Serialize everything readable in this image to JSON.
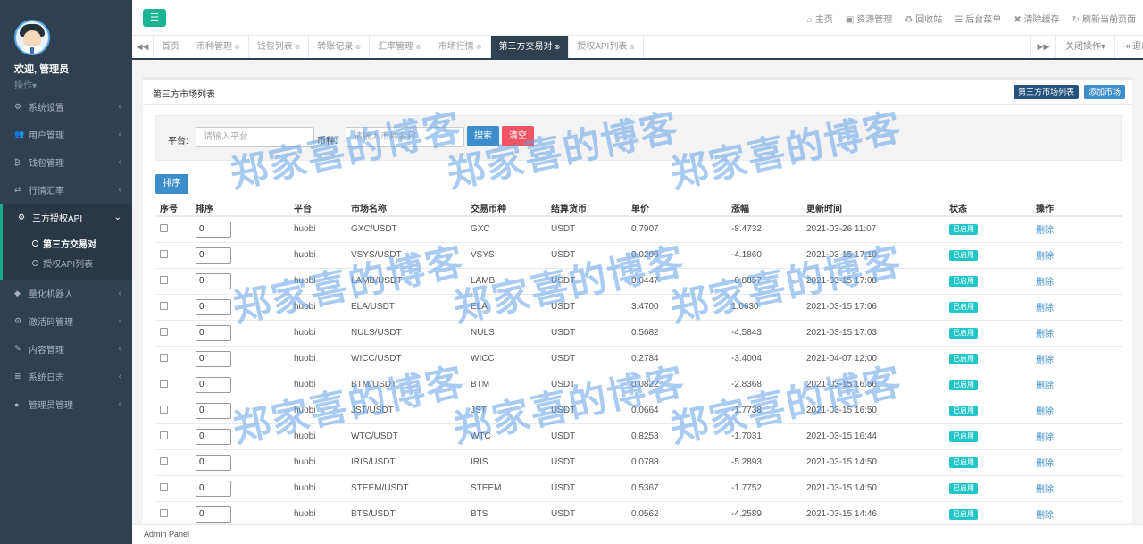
{
  "sidebar": {
    "welcome": "欢迎, 管理员",
    "operations": "操作▾",
    "menu_before": [
      {
        "label": "系统设置",
        "icon": "⚙",
        "name": "cog-icon"
      },
      {
        "label": "用户管理",
        "icon": "👥",
        "name": "users-icon"
      },
      {
        "label": "钱包管理",
        "icon": "₿",
        "name": "bitcoin-icon"
      },
      {
        "label": "行情汇率",
        "icon": "⇄",
        "name": "exchange-icon"
      }
    ],
    "active_menu": {
      "label": "三方授权API",
      "icon": "⚙"
    },
    "submenu": [
      {
        "label": "第三方交易对"
      },
      {
        "label": "授权API列表"
      }
    ],
    "menu_after": [
      {
        "label": "量化机器人",
        "icon": "◆",
        "name": "robot-icon"
      },
      {
        "label": "激活码管理",
        "icon": "⚙",
        "name": "key-icon"
      },
      {
        "label": "内容管理",
        "icon": "✎",
        "name": "edit-icon"
      },
      {
        "label": "系统日志",
        "icon": "≣",
        "name": "log-icon"
      },
      {
        "label": "管理员管理",
        "icon": "●",
        "name": "admin-icon"
      }
    ]
  },
  "topbar": {
    "actions": [
      {
        "label": "主页",
        "icon": "⌂"
      },
      {
        "label": "资源管理",
        "icon": "▣"
      },
      {
        "label": "回收站",
        "icon": "♻"
      },
      {
        "label": "后台菜单",
        "icon": "☰"
      },
      {
        "label": "清除缓存",
        "icon": "✖"
      },
      {
        "label": "刷新当前页面",
        "icon": "↻"
      }
    ]
  },
  "tabs": [
    {
      "label": "首页",
      "closable": false,
      "active": false
    },
    {
      "label": "币种管理",
      "closable": true,
      "active": false
    },
    {
      "label": "钱包列表",
      "closable": true,
      "active": false
    },
    {
      "label": "转账记录",
      "closable": true,
      "active": false
    },
    {
      "label": "汇率管理",
      "closable": true,
      "active": false
    },
    {
      "label": "市场行情",
      "closable": true,
      "active": false
    },
    {
      "label": "第三方交易对",
      "closable": true,
      "active": true
    },
    {
      "label": "授权API列表",
      "closable": true,
      "active": false
    }
  ],
  "tab_right": {
    "close_ops": "关闭操作▾",
    "exit": "退出"
  },
  "panel": {
    "title": "第三方市场列表",
    "btn_list": "第三方市场列表",
    "btn_add": "添加市场"
  },
  "search": {
    "platform_label": "平台:",
    "platform_placeholder": "请输入平台",
    "coin_label": "币种:",
    "coin_placeholder": "请输入币种名称",
    "search_btn": "搜索",
    "clear_btn": "清空"
  },
  "sort_btn": "排序",
  "table": {
    "headers": [
      "序号",
      "排序",
      "平台",
      "市场名称",
      "交易币种",
      "结算货币",
      "单价",
      "涨幅",
      "更新时间",
      "状态",
      "操作"
    ],
    "rows": [
      {
        "sort": "0",
        "platform": "huobi",
        "market": "GXC/USDT",
        "coin": "GXC",
        "settle": "USDT",
        "price": "0.7907",
        "change": "-8.4732",
        "time": "2021-03-26 11:07",
        "status": "已启用",
        "action": "删除"
      },
      {
        "sort": "0",
        "platform": "huobi",
        "market": "VSYS/USDT",
        "coin": "VSYS",
        "settle": "USDT",
        "price": "0.0206",
        "change": "-4.1860",
        "time": "2021-03-15 17:10",
        "status": "已启用",
        "action": "删除"
      },
      {
        "sort": "0",
        "platform": "huobi",
        "market": "LAMB/USDT",
        "coin": "LAMB",
        "settle": "USDT",
        "price": "0.0447",
        "change": "-0.8857",
        "time": "2021-03-15 17:08",
        "status": "已启用",
        "action": "删除"
      },
      {
        "sort": "0",
        "platform": "huobi",
        "market": "ELA/USDT",
        "coin": "ELA",
        "settle": "USDT",
        "price": "3.4700",
        "change": "1.0630",
        "time": "2021-03-15 17:06",
        "status": "已启用",
        "action": "删除"
      },
      {
        "sort": "0",
        "platform": "huobi",
        "market": "NULS/USDT",
        "coin": "NULS",
        "settle": "USDT",
        "price": "0.5682",
        "change": "-4.5843",
        "time": "2021-03-15 17:03",
        "status": "已启用",
        "action": "删除"
      },
      {
        "sort": "0",
        "platform": "huobi",
        "market": "WICC/USDT",
        "coin": "WICC",
        "settle": "USDT",
        "price": "0.2784",
        "change": "-3.4004",
        "time": "2021-04-07 12:00",
        "status": "已启用",
        "action": "删除"
      },
      {
        "sort": "0",
        "platform": "huobi",
        "market": "BTM/USDT",
        "coin": "BTM",
        "settle": "USDT",
        "price": "0.0822",
        "change": "-2.8368",
        "time": "2021-03-15 16:56",
        "status": "已启用",
        "action": "删除"
      },
      {
        "sort": "0",
        "platform": "huobi",
        "market": "JST/USDT",
        "coin": "JST",
        "settle": "USDT",
        "price": "0.0664",
        "change": "-1.7738",
        "time": "2021-03-15 16:50",
        "status": "已启用",
        "action": "删除"
      },
      {
        "sort": "0",
        "platform": "huobi",
        "market": "WTC/USDT",
        "coin": "WTC",
        "settle": "USDT",
        "price": "0.8253",
        "change": "-1.7031",
        "time": "2021-03-15 16:44",
        "status": "已启用",
        "action": "删除"
      },
      {
        "sort": "0",
        "platform": "huobi",
        "market": "IRIS/USDT",
        "coin": "IRIS",
        "settle": "USDT",
        "price": "0.0788",
        "change": "-5.2893",
        "time": "2021-03-15 14:50",
        "status": "已启用",
        "action": "删除"
      },
      {
        "sort": "0",
        "platform": "huobi",
        "market": "STEEM/USDT",
        "coin": "STEEM",
        "settle": "USDT",
        "price": "0.5367",
        "change": "-1.7752",
        "time": "2021-03-15 14:50",
        "status": "已启用",
        "action": "删除"
      },
      {
        "sort": "0",
        "platform": "huobi",
        "market": "BTS/USDT",
        "coin": "BTS",
        "settle": "USDT",
        "price": "0.0562",
        "change": "-4.2589",
        "time": "2021-03-15 14:46",
        "status": "已启用",
        "action": "删除"
      }
    ]
  },
  "footer": "Admin Panel",
  "watermark": "郑家喜的博客",
  "colors": {
    "sidebar": "#2f4050",
    "accent": "#1ab394",
    "primary": "#3c8dcc",
    "danger": "#ed5565",
    "badge": "#23c6c8"
  }
}
